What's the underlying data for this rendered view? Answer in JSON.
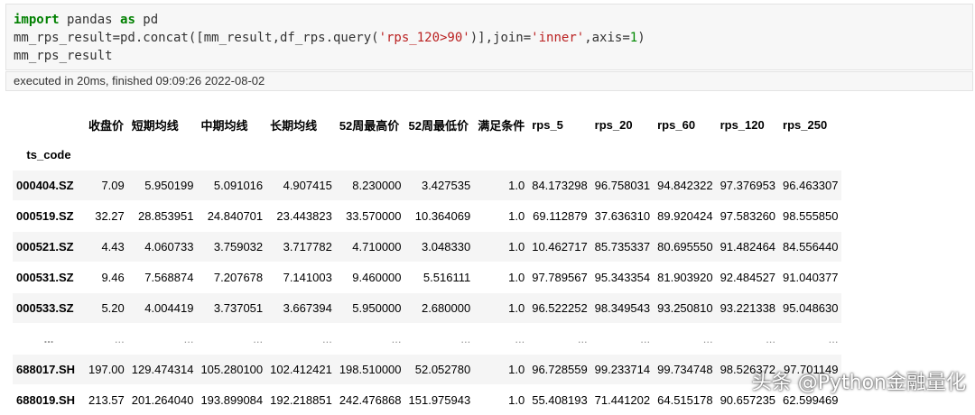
{
  "code_cell": {
    "line1": {
      "kw1": "import",
      "mid": " pandas ",
      "kw2": "as",
      "end": " pd"
    },
    "line2": {
      "pre": "mm_rps_result=pd.concat([mm_result,df_rps.query(",
      "str1": "'rps_120>90'",
      "mid": ")],join=",
      "str2": "'inner'",
      "mid2": ",axis=",
      "num": "1",
      "end": ")"
    },
    "line3": "mm_rps_result"
  },
  "exec_status": "executed in 20ms, finished 09:09:26 2022-08-02",
  "table": {
    "index_name": "ts_code",
    "columns": [
      "收盘价",
      "短期均线",
      "中期均线",
      "长期均线",
      "52周最高价",
      "52周最低价",
      "满足条件",
      "rps_5",
      "rps_20",
      "rps_60",
      "rps_120",
      "rps_250"
    ],
    "rows": [
      {
        "index": "000404.SZ",
        "values": [
          "7.09",
          "5.950199",
          "5.091016",
          "4.907415",
          "8.230000",
          "3.427535",
          "1.0",
          "84.173298",
          "96.758031",
          "94.842322",
          "97.376953",
          "96.463307"
        ]
      },
      {
        "index": "000519.SZ",
        "values": [
          "32.27",
          "28.853951",
          "24.840701",
          "23.443823",
          "33.570000",
          "10.364069",
          "1.0",
          "69.112879",
          "37.636310",
          "89.920424",
          "97.583260",
          "98.555850"
        ]
      },
      {
        "index": "000521.SZ",
        "values": [
          "4.43",
          "4.060733",
          "3.759032",
          "3.717782",
          "4.710000",
          "3.048330",
          "1.0",
          "10.462717",
          "85.735337",
          "80.695550",
          "91.482464",
          "84.556440"
        ]
      },
      {
        "index": "000531.SZ",
        "values": [
          "9.46",
          "7.568874",
          "7.207678",
          "7.141003",
          "9.460000",
          "5.516111",
          "1.0",
          "97.789567",
          "95.343354",
          "81.903920",
          "92.484527",
          "91.040377"
        ]
      },
      {
        "index": "000533.SZ",
        "values": [
          "5.20",
          "4.004419",
          "3.737051",
          "3.667394",
          "5.950000",
          "2.680000",
          "1.0",
          "96.522252",
          "98.349543",
          "93.250810",
          "93.221338",
          "95.048630"
        ]
      },
      {
        "index": "...",
        "values": [
          "...",
          "...",
          "...",
          "...",
          "...",
          "...",
          "...",
          "...",
          "...",
          "...",
          "...",
          "..."
        ]
      },
      {
        "index": "688017.SH",
        "values": [
          "197.00",
          "129.474314",
          "105.280100",
          "102.412421",
          "198.510000",
          "52.052780",
          "1.0",
          "96.728559",
          "99.233714",
          "99.734748",
          "98.526372",
          "97.701149"
        ]
      },
      {
        "index": "688019.SH",
        "values": [
          "213.57",
          "201.264040",
          "193.899084",
          "192.218851",
          "242.476868",
          "151.975943",
          "1.0",
          "55.408193",
          "71.441202",
          "64.515178",
          "90.657235",
          "62.599469"
        ]
      }
    ]
  },
  "watermark": "头条 @Python金融量化"
}
